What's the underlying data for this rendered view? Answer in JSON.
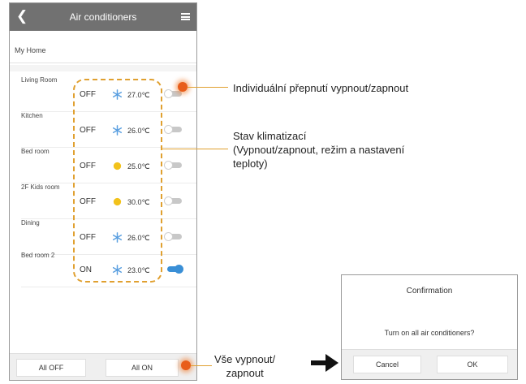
{
  "header": {
    "back_icon": "chevron-left-icon",
    "title": "Air conditioners",
    "menu_icon": "hamburger-menu-icon"
  },
  "home": {
    "label": "My Home"
  },
  "rooms": [
    {
      "name": "Living Room",
      "state": "OFF",
      "mode_icon": "snowflake-icon",
      "temp": "27.0℃",
      "toggle_on": false,
      "highlighted": true
    },
    {
      "name": "Kitchen",
      "state": "OFF",
      "mode_icon": "snowflake-icon",
      "temp": "26.0℃",
      "toggle_on": false
    },
    {
      "name": "Bed room",
      "state": "OFF",
      "mode_icon": "sun-icon",
      "temp": "25.0℃",
      "toggle_on": false
    },
    {
      "name": "2F Kids room",
      "state": "OFF",
      "mode_icon": "sun-icon",
      "temp": "30.0℃",
      "toggle_on": false
    },
    {
      "name": "Dining",
      "state": "OFF",
      "mode_icon": "snowflake-icon",
      "temp": "26.0℃",
      "toggle_on": false
    },
    {
      "name": "Bed room 2",
      "state": "ON",
      "mode_icon": "snowflake-icon",
      "temp": "23.0℃",
      "toggle_on": true
    }
  ],
  "bottom_bar": {
    "all_off_label": "All OFF",
    "all_on_label": "All ON"
  },
  "callouts": {
    "toggle": "Individuální přepnutí vypnout/zapnout",
    "status_line1": "Stav klimatizací",
    "status_line2": "(Vypnout/zapnout, režim a nastavení",
    "status_line3": "teploty)",
    "all_line1": "Vše vypnout/",
    "all_line2": "zapnout"
  },
  "dialog": {
    "title": "Confirmation",
    "message": "Turn on all air conditioners?",
    "cancel_label": "Cancel",
    "ok_label": "OK"
  },
  "colors": {
    "header_bg": "#717171",
    "dash_border": "#e0a030",
    "highlight": "#e85d1a",
    "toggle_on": "#3a8fd6",
    "snowflake": "#5a9fe0",
    "sun": "#f2c21b"
  }
}
